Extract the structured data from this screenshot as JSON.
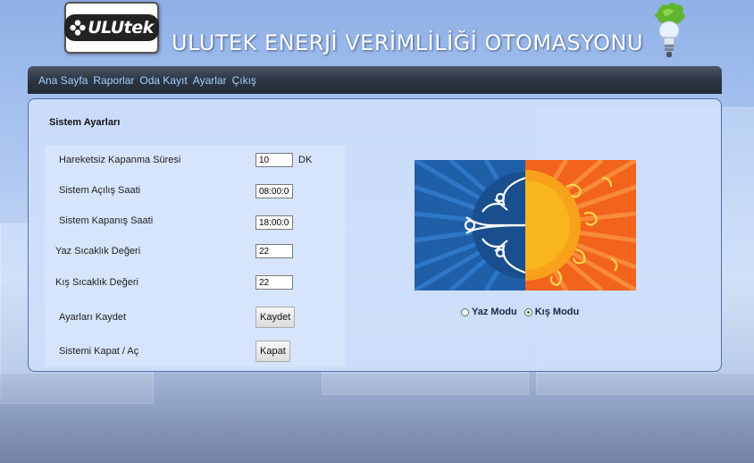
{
  "header": {
    "logo_text": "ULUtek",
    "title": "ULUTEK ENERJİ VERİMLİLİĞİ OTOMASYONU"
  },
  "nav": {
    "items": [
      "Ana Sayfa",
      "Raporlar",
      "Oda Kayıt",
      "Ayarlar",
      "Çıkış"
    ]
  },
  "panel": {
    "title": "Sistem Ayarları",
    "fields": {
      "idle_close": {
        "label": "Hareketsiz Kapanma Süresi",
        "value": "10",
        "unit": "DK"
      },
      "open_time": {
        "label": "Sistem Açılış Saati",
        "value": "08:00:00"
      },
      "close_time": {
        "label": "Sistem Kapanış Saati",
        "value": "18:00:00"
      },
      "summer_temp": {
        "label": "Yaz Sıcaklık Değeri",
        "value": "22"
      },
      "winter_temp": {
        "label": "Kış Sıcaklık Değeri",
        "value": "22"
      }
    },
    "save": {
      "label": "Ayarları Kaydet",
      "button": "Kaydet"
    },
    "toggle": {
      "label": "Sistemi Kapat / Aç",
      "button": "Kapat"
    },
    "modes": {
      "summer": "Yaz Modu",
      "winter": "Kış Modu",
      "selected": "winter"
    }
  },
  "colors": {
    "nav_link": "#9fd2ff",
    "winter_blue": "#1f5fa8",
    "summer_orange": "#f2631c",
    "sun_yellow": "#f9b51d"
  }
}
